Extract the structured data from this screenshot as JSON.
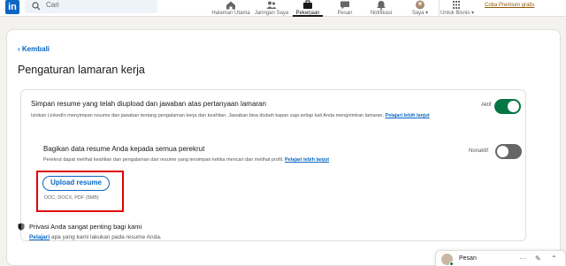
{
  "nav": {
    "logo_text": "in",
    "search_placeholder": "Cari",
    "items": [
      {
        "label": "Halaman Utama",
        "icon": "home-icon"
      },
      {
        "label": "Jaringan Saya",
        "icon": "network-icon"
      },
      {
        "label": "Pekerjaan",
        "icon": "jobs-icon",
        "active": true
      },
      {
        "label": "Pesan",
        "icon": "messaging-icon"
      },
      {
        "label": "Notifikasi",
        "icon": "bell-icon"
      },
      {
        "label": "Saya ▾",
        "icon": "profile-icon"
      },
      {
        "label": "Untuk Bisnis ▾",
        "icon": "grid-icon"
      }
    ],
    "premium_link": "Coba Premium gratis"
  },
  "page": {
    "back_label": "Kembali",
    "title": "Pengaturan lamaran kerja"
  },
  "resume_setting": {
    "title": "Simpan resume yang telah diupload dan jawaban atas pertanyaan lamaran",
    "desc": "Izinkan LinkedIn menyimpan resume dan jawaban tentang pengalaman kerja dan keahlian. Jawaban bisa diubah kapan saja setiap kali Anda mengirimkan lamaran.",
    "link": "Pelajari lebih lanjut",
    "toggle_label": "Aktif",
    "toggle_on": true
  },
  "share_setting": {
    "title": "Bagikan data resume Anda kepada semua perekrut",
    "desc": "Perekrut dapat melihat keahlian dan pengalaman dari resume yang tersimpan ketika mencari dan melihat profil.",
    "link": "Pelajari lebih lanjut",
    "toggle_label": "Nonaktif",
    "toggle_on": false
  },
  "upload": {
    "button_label": "Upload resume",
    "hint": "DOC, DOCX, PDF (5MB)"
  },
  "privacy": {
    "title": "Privasi Anda sangat penting bagi kami",
    "link": "Pelajari",
    "desc": "apa yang kami lakukan pada resume Anda."
  },
  "messaging": {
    "label": "Pesan",
    "icons": [
      "more-icon",
      "compose-icon",
      "chevron-up-icon"
    ]
  },
  "colors": {
    "brand": "#0a66c2",
    "toggle_on": "#057642",
    "highlight": "#e00000",
    "premium": "#915907"
  }
}
